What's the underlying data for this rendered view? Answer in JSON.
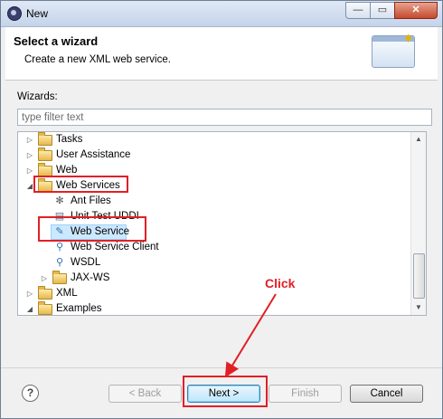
{
  "window": {
    "title": "New",
    "minimize": "—",
    "maximize": "▭",
    "close": "✕"
  },
  "banner": {
    "title": "Select a wizard",
    "description": "Create a new XML web service.",
    "icon": "new-wizard-icon"
  },
  "wizards_label": "Wizards:",
  "filter": {
    "placeholder": "type filter text",
    "value": ""
  },
  "tree": {
    "items": [
      {
        "label": "Tasks",
        "kind": "folder",
        "expanded": false
      },
      {
        "label": "User Assistance",
        "kind": "folder",
        "expanded": false
      },
      {
        "label": "Web",
        "kind": "folder",
        "expanded": false
      },
      {
        "label": "Web Services",
        "kind": "folder",
        "expanded": true,
        "highlighted": true
      },
      {
        "label": "Ant Files",
        "kind": "item",
        "icon": "ant-icon"
      },
      {
        "label": "Unit Test UDDI",
        "kind": "item",
        "icon": "document-icon"
      },
      {
        "label": "Web Service",
        "kind": "item",
        "icon": "web-service-icon",
        "selected": true,
        "highlighted": true
      },
      {
        "label": "Web Service Client",
        "kind": "item",
        "icon": "web-service-client-icon"
      },
      {
        "label": "WSDL",
        "kind": "item",
        "icon": "wsdl-icon"
      },
      {
        "label": "JAX-WS",
        "kind": "folder",
        "expanded": false
      },
      {
        "label": "XML",
        "kind": "folder",
        "expanded": false
      },
      {
        "label": "Examples",
        "kind": "folder",
        "expanded": true
      }
    ]
  },
  "annotation": {
    "text": "Click",
    "color": "#e21f26"
  },
  "buttons": {
    "help": "?",
    "back": "< Back",
    "next": "Next >",
    "finish": "Finish",
    "cancel": "Cancel"
  },
  "colors": {
    "highlight": "#e21f26",
    "selection": "#cce8ff"
  }
}
